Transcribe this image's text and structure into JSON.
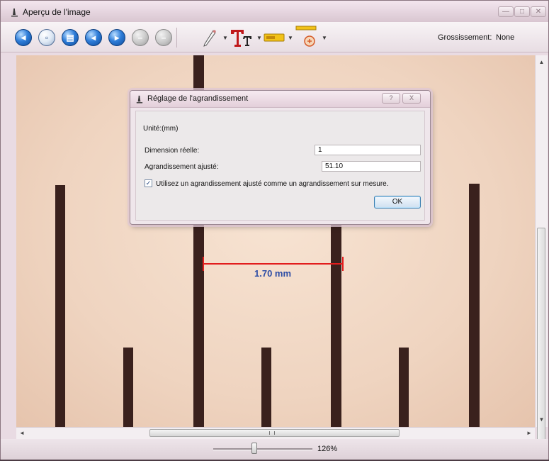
{
  "window": {
    "title": "Aperçu de l'image"
  },
  "toolbar": {
    "zoom_label": "Grossissement:",
    "zoom_value": "None",
    "buttons": [
      "back-icon",
      "new-document-icon",
      "print-icon",
      "previous-icon",
      "next-icon",
      "rotate-left-icon",
      "rotate-right-icon",
      "pencil-icon",
      "text-tool-icon",
      "measure-tool-icon",
      "compass-tool-icon"
    ]
  },
  "measurement": {
    "label": "1.70 mm",
    "color": "#e21d1d"
  },
  "dialog": {
    "title": "Réglage de l'agrandissement",
    "unit_label": "Unité:(mm)",
    "real_dimension_label": "Dimension réelle:",
    "real_dimension_value": "1",
    "adjusted_zoom_label": "Agrandissement ajusté:",
    "adjusted_zoom_value": "51.10",
    "checkbox_label": "Utilisez un agrandissement ajusté comme un agrandissement sur mesure.",
    "checkbox_checked": true,
    "ok_label": "OK",
    "help_glyph": "?",
    "close_glyph": "X"
  },
  "status": {
    "zoom_percent": "126%"
  },
  "colors": {
    "accent_blue": "#2f7ed9",
    "tick_color": "#3a211d",
    "measure_text": "#2d4da5"
  }
}
